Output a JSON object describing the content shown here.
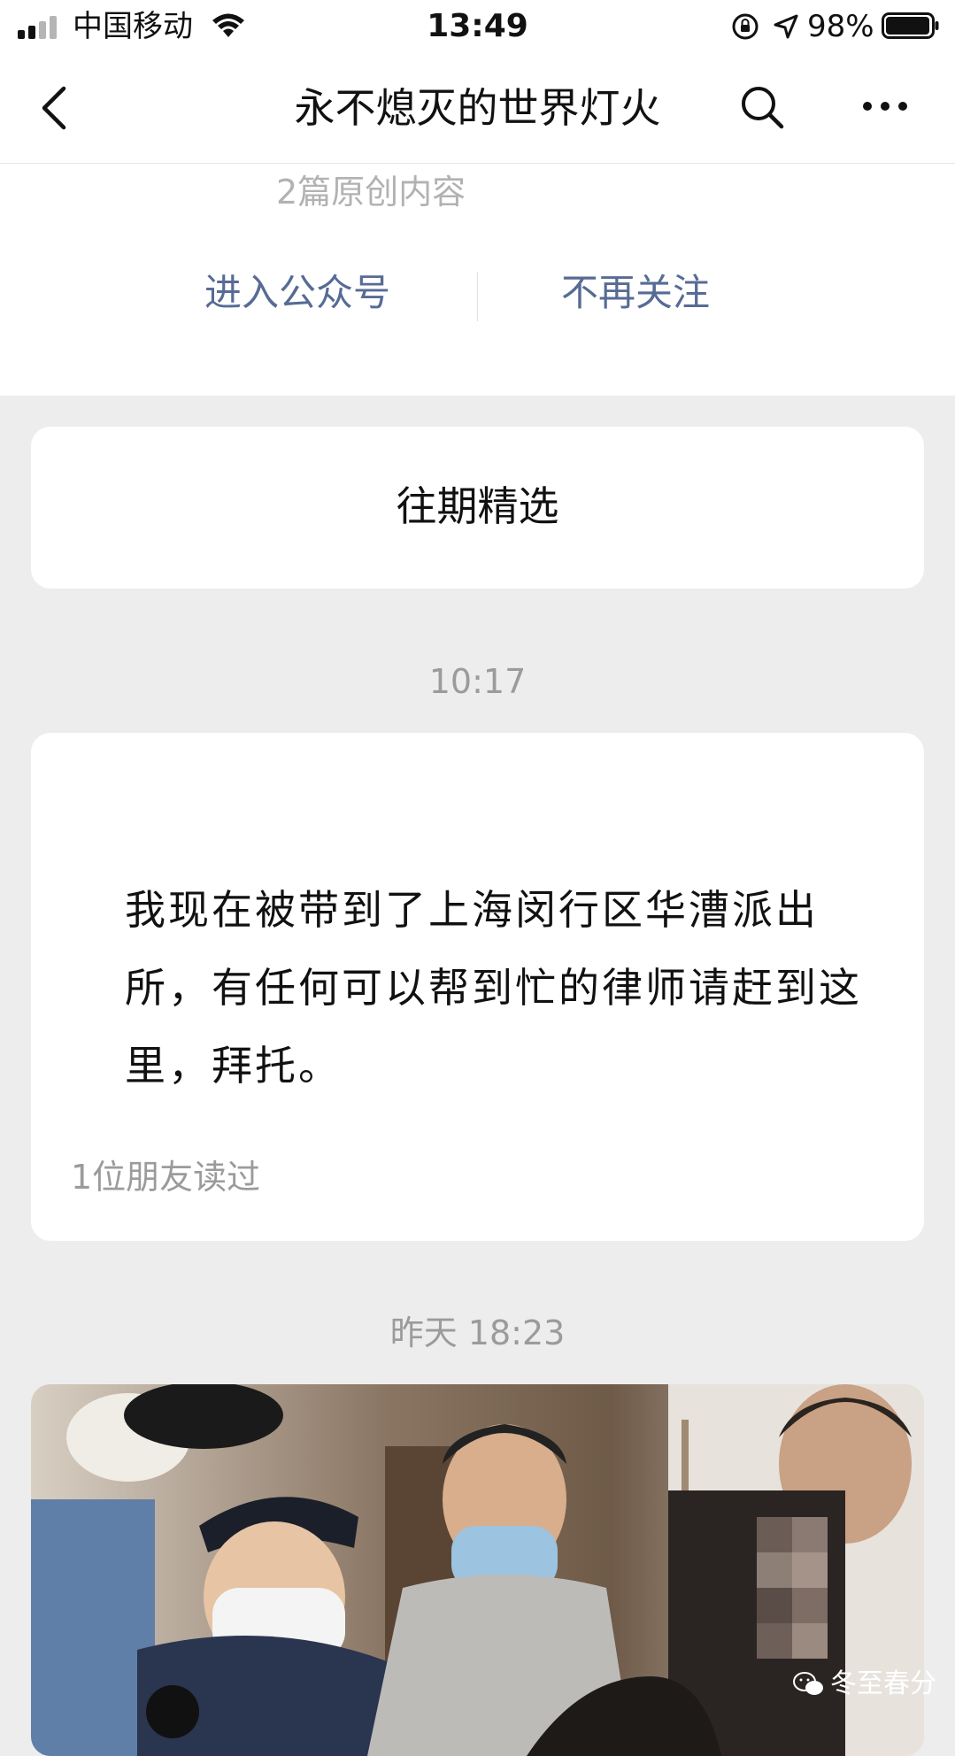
{
  "status_bar": {
    "carrier": "中国移动",
    "time": "13:49",
    "battery_percent": "98%",
    "battery_level": 0.98,
    "icons": [
      "signal-icon",
      "wifi-icon",
      "rotation-lock-icon",
      "location-icon",
      "battery-icon"
    ]
  },
  "nav": {
    "title": "永不熄灭的世界灯火",
    "back_icon": "chevron-left-icon",
    "search_icon": "search-icon",
    "more_icon": "more-icon"
  },
  "account": {
    "original_count": "2篇原创内容",
    "enter_label": "进入公众号",
    "unfollow_label": "不再关注"
  },
  "history": {
    "label": "往期精选"
  },
  "messages": [
    {
      "time": "10:17",
      "body": "我现在被带到了上海闵行区华漕派出所，有任何可以帮到忙的律师请赶到这里，拜托。",
      "read_count": "1位朋友读过"
    },
    {
      "time": "昨天 18:23"
    }
  ],
  "watermark": {
    "text": "冬至春分",
    "icon": "wechat-icon"
  },
  "colors": {
    "link": "#576b95",
    "background": "#ededed",
    "muted": "#9b9b9b"
  }
}
